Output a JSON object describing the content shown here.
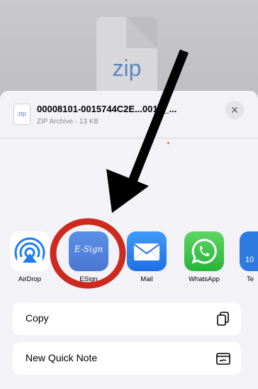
{
  "background": {
    "zip_label": "zip"
  },
  "share_sheet": {
    "file": {
      "icon_label": "zip",
      "name": "00008101-0015744C2E...001E_...",
      "meta": "ZIP Archive · 13 KB"
    },
    "close_icon": "×",
    "apps": [
      {
        "name": "AirDrop",
        "icon": "airdrop-icon"
      },
      {
        "name": "ESign",
        "icon": "esign-icon",
        "tile_text": "E-Sign"
      },
      {
        "name": "Mail",
        "icon": "mail-icon"
      },
      {
        "name": "WhatsApp",
        "icon": "whatsapp-icon"
      },
      {
        "name": "Te",
        "icon": "partial-app-icon",
        "tile_text": "10"
      }
    ],
    "actions": [
      {
        "label": "Copy",
        "icon": "copy-icon"
      },
      {
        "label": "New Quick Note",
        "icon": "quick-note-icon"
      }
    ]
  },
  "annotations": {
    "arrow_color": "#000000",
    "circle_color": "#cc2a1f"
  }
}
